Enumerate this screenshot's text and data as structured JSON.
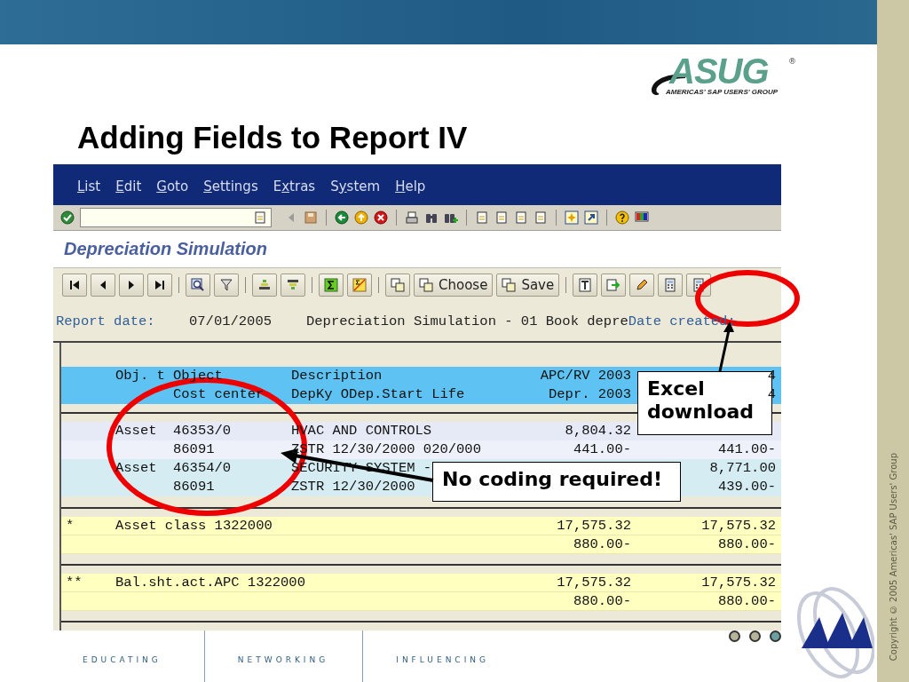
{
  "slide": {
    "title": "Adding Fields to Report IV",
    "copyright": "Copyright © 2005 Americas' SAP Users' Group"
  },
  "logo": {
    "name": "ASUG",
    "mark": "®",
    "tagline": "AMERICAS' SAP USERS' GROUP"
  },
  "sap": {
    "menu": [
      {
        "key": "L",
        "post": "ist"
      },
      {
        "key": "E",
        "post": "dit"
      },
      {
        "key": "G",
        "post": "oto"
      },
      {
        "key": "S",
        "post": "ettings"
      },
      {
        "pre": "E",
        "key": "x",
        "post": "tras"
      },
      {
        "pre": "S",
        "key": "y",
        "post": "stem"
      },
      {
        "key": "H",
        "post": "elp"
      }
    ],
    "screen_title": "Depreciation Simulation",
    "app_buttons": [
      {
        "label": "Choose"
      },
      {
        "label": "Save"
      }
    ],
    "report_line": {
      "label": "Report date:",
      "date": "07/01/2005",
      "text": "Depreciation Simulation - 01 Book depre",
      "label_2": "Date created:"
    },
    "table": {
      "header": [
        {
          "type": "Obj. t",
          "object": "Object",
          "description": "Description",
          "column_1": "APC/RV 2003",
          "column_2": "4"
        },
        {
          "object": "Cost center",
          "description": "DepKy ODep.Start Life",
          "column_1": "Depr. 2003",
          "column_2": "4"
        }
      ],
      "groups": [
        {
          "kind": "item",
          "lines": [
            {
              "type": "Asset",
              "object": "46353/0",
              "description": "HVAC AND CONTROLS",
              "value_1": "8,804.32"
            },
            {
              "object": "86091",
              "description": "ZSTR  12/30/2000 020/000",
              "value_1": "441.00-",
              "value_2": "441.00-"
            }
          ]
        },
        {
          "kind": "item",
          "lines": [
            {
              "type": "Asset",
              "object": "46354/0",
              "description": "SECURITY SYSTEM -",
              "value_2": "8,771.00"
            },
            {
              "object": "86091",
              "description": "ZSTR  12/30/2000",
              "value_2": "439.00-"
            }
          ]
        },
        {
          "kind": "total",
          "lines": [
            {
              "prefix": "*",
              "label": "Asset class 1322000",
              "value_1": "17,575.32",
              "value_2": "17,575.32"
            },
            {
              "value_1": "880.00-",
              "value_2": "880.00-"
            }
          ]
        },
        {
          "kind": "total",
          "lines": [
            {
              "prefix": "**",
              "label": "Bal.sht.act.APC 1322000",
              "value_1": "17,575.32",
              "value_2": "17,575.32"
            },
            {
              "value_1": "880.00-",
              "value_2": "880.00-"
            }
          ]
        }
      ]
    }
  },
  "callouts": [
    {
      "text": "Excel download"
    },
    {
      "text": "No coding required!"
    }
  ],
  "footer": [
    "EDUCATING",
    "NETWORKING",
    "INFLUENCING"
  ]
}
